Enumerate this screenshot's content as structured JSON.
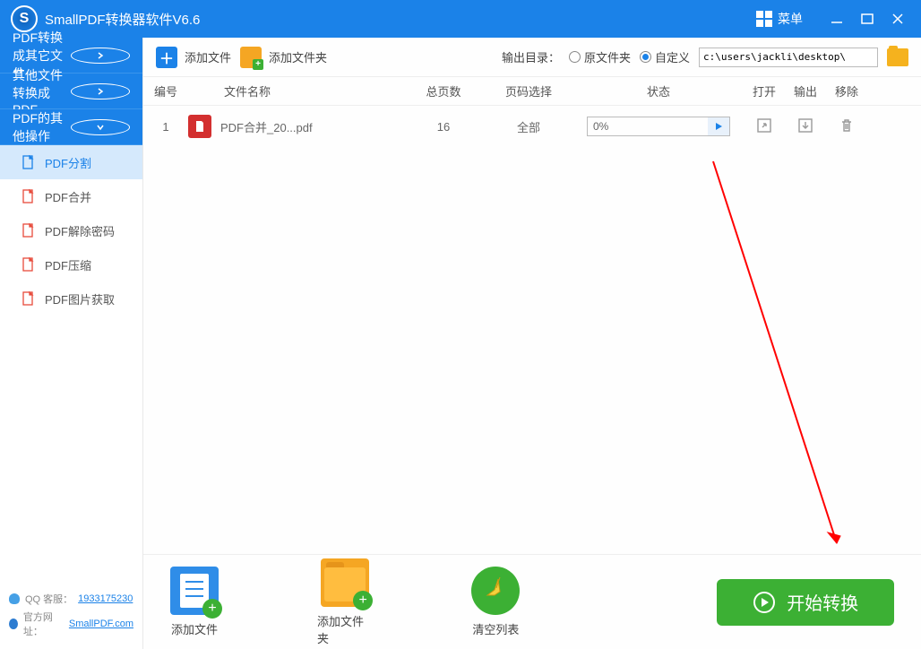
{
  "titlebar": {
    "title": "SmallPDF转换器软件V6.6",
    "menu": "菜单"
  },
  "sidebar": {
    "sections": [
      {
        "label": "PDF转换成其它文件"
      },
      {
        "label": "其他文件转换成PDF"
      },
      {
        "label": "PDF的其他操作"
      }
    ],
    "items": [
      {
        "label": "PDF分割"
      },
      {
        "label": "PDF合并"
      },
      {
        "label": "PDF解除密码"
      },
      {
        "label": "PDF压缩"
      },
      {
        "label": "PDF图片获取"
      }
    ],
    "footer": {
      "qq_prefix": "QQ 客服：",
      "qq": "1933175230",
      "site_prefix": "官方网址：",
      "site": "SmallPDF.com"
    }
  },
  "toolbar": {
    "add_file": "添加文件",
    "add_folder": "添加文件夹",
    "output_label": "输出目录：",
    "radio_source": "原文件夹",
    "radio_custom": "自定义",
    "path_value": "c:\\users\\jackli\\desktop\\"
  },
  "table": {
    "headers": {
      "idx": "编号",
      "name": "文件名称",
      "pages": "总页数",
      "sel": "页码选择",
      "status": "状态",
      "open": "打开",
      "out": "输出",
      "del": "移除"
    },
    "rows": [
      {
        "idx": "1",
        "name": "PDF合并_20...pdf",
        "pages": "16",
        "sel": "全部",
        "progress": "0%"
      }
    ]
  },
  "bottombar": {
    "add_file": "添加文件",
    "add_folder": "添加文件夹",
    "clear": "清空列表",
    "start": "开始转换"
  }
}
